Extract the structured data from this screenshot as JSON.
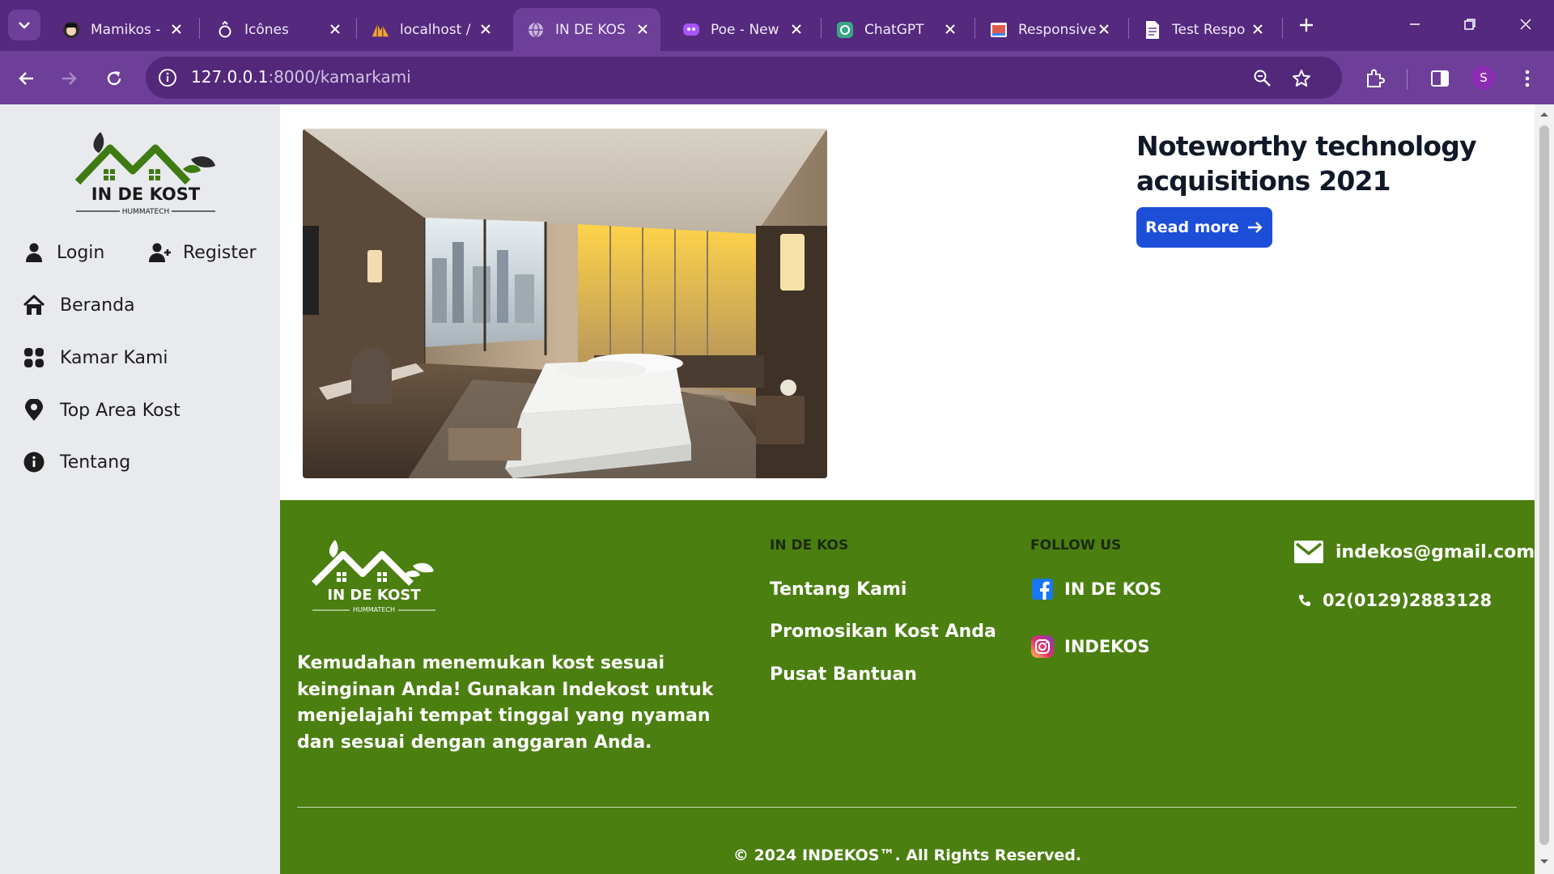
{
  "browser": {
    "tabs": [
      {
        "title": "Mamikos -",
        "icon": "mamikos-favicon"
      },
      {
        "title": "Icônes",
        "icon": "icones-favicon"
      },
      {
        "title": "localhost /",
        "icon": "phpmyadmin-favicon"
      },
      {
        "title": "IN DE KOS",
        "icon": "globe-favicon",
        "active": true
      },
      {
        "title": "Poe - New",
        "icon": "poe-favicon"
      },
      {
        "title": "ChatGPT",
        "icon": "chatgpt-favicon"
      },
      {
        "title": "Responsive",
        "icon": "responsive-favicon"
      },
      {
        "title": "Test Respo",
        "icon": "document-favicon"
      }
    ],
    "url_host": "127.0.0.1",
    "url_path": ":8000/kamarkami",
    "profile_initial": "S"
  },
  "sidebar": {
    "logo_text": "IN DE KOST",
    "logo_subtext": "HUMMATECH",
    "login_label": "Login",
    "register_label": "Register",
    "items": [
      {
        "label": "Beranda",
        "icon": "home-icon"
      },
      {
        "label": "Kamar Kami",
        "icon": "grid-icon"
      },
      {
        "label": "Top Area Kost",
        "icon": "map-pin-icon"
      },
      {
        "label": "Tentang",
        "icon": "info-icon"
      }
    ]
  },
  "main": {
    "card_title": "Noteworthy technology acquisitions 2021",
    "read_more_label": "Read more"
  },
  "footer": {
    "logo_text": "IN DE KOST",
    "logo_subtext": "HUMMATECH",
    "description": "Kemudahan menemukan kost sesuai keinginan Anda! Gunakan Indekost untuk menjelajahi tempat tinggal yang nyaman dan sesuai dengan anggaran Anda.",
    "col1_heading": "IN DE KOS",
    "col1_links": [
      "Tentang Kami",
      "Promosikan Kost Anda",
      "Pusat Bantuan"
    ],
    "col2_heading": "FOLLOW US",
    "socials": [
      {
        "label": "IN DE KOS",
        "icon": "facebook-icon"
      },
      {
        "label": "INDEKOS",
        "icon": "instagram-icon"
      }
    ],
    "email": "indekos@gmail.com",
    "phone": "02(0129)2883128",
    "copyright": "© 2024 INDEKOS™. All Rights Reserved."
  },
  "colors": {
    "chrome_dark": "#55297e",
    "chrome_light": "#6d3f98",
    "sidebar_bg": "#e8eaee",
    "footer_bg": "#4b7f10",
    "button_blue": "#1d4ed8"
  }
}
